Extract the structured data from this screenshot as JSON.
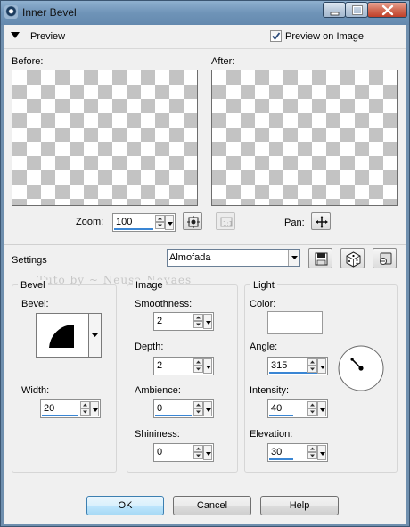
{
  "window": {
    "title": "Inner Bevel",
    "icon": "app-icon",
    "caption_buttons": [
      "minimize-icon",
      "maximize-icon",
      "close-icon"
    ]
  },
  "preview": {
    "label": "Preview",
    "preview_on_image_label": "Preview on Image",
    "preview_on_image_checked": true,
    "before_label": "Before:",
    "after_label": "After:",
    "zoom_label": "Zoom:",
    "zoom_value": "100",
    "pan_label": "Pan:"
  },
  "settings": {
    "label": "Settings",
    "preset_value": "Almofada",
    "watermark": "Tuto by ~ Neusa Novaes"
  },
  "bevel": {
    "title": "Bevel",
    "bevel_label": "Bevel:",
    "width_label": "Width:",
    "width_value": "20"
  },
  "image": {
    "title": "Image",
    "smoothness_label": "Smoothness:",
    "smoothness_value": "2",
    "depth_label": "Depth:",
    "depth_value": "2",
    "ambience_label": "Ambience:",
    "ambience_value": "0",
    "shininess_label": "Shininess:",
    "shininess_value": "0"
  },
  "light": {
    "title": "Light",
    "color_label": "Color:",
    "color_value": "#ffffff",
    "angle_label": "Angle:",
    "angle_value": "315",
    "intensity_label": "Intensity:",
    "intensity_value": "40",
    "elevation_label": "Elevation:",
    "elevation_value": "30"
  },
  "buttons": {
    "ok": "OK",
    "cancel": "Cancel",
    "help": "Help"
  }
}
